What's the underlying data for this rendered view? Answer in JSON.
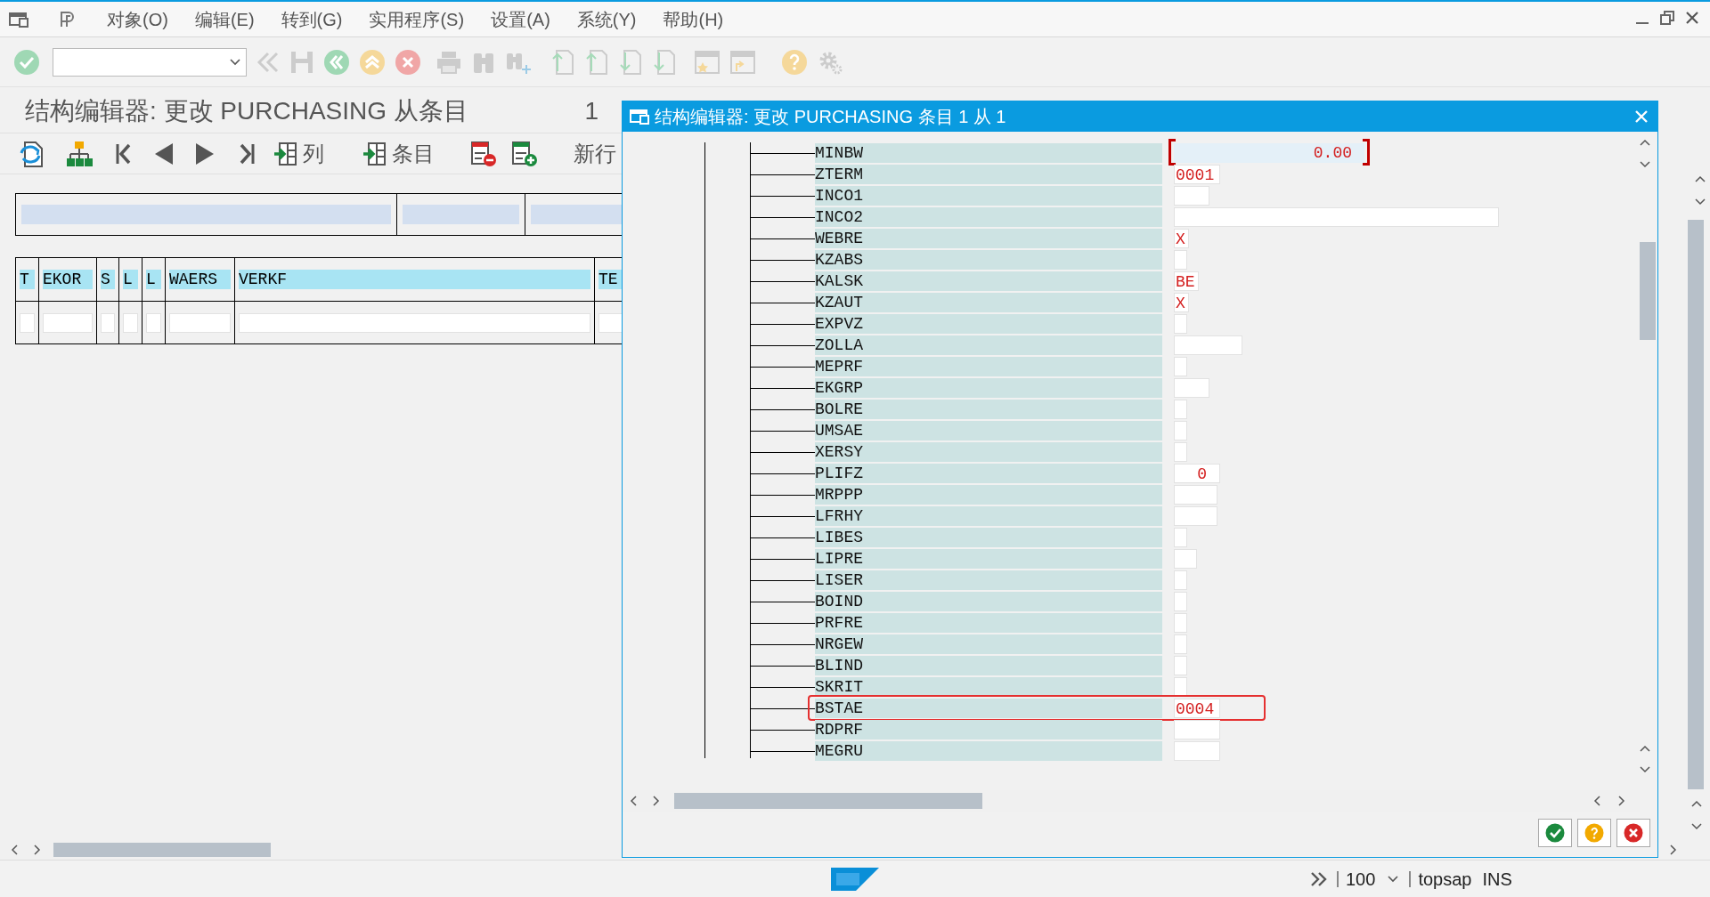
{
  "menu_bar": {
    "items": [
      "对象(O)",
      "编辑(E)",
      "转到(G)",
      "实用程序(S)",
      "设置(A)",
      "系统(Y)",
      "帮助(H)"
    ]
  },
  "screen": {
    "title": "结构编辑器: 更改 PURCHASING 从条目",
    "entry_count": "1"
  },
  "app_toolbar": {
    "columns_label": "列",
    "entries_label": "条目",
    "new_row_button": "新行"
  },
  "table": {
    "columns": [
      "T",
      "EKOR",
      "S",
      "L",
      "L",
      "WAERS",
      "VERKF",
      "TE"
    ]
  },
  "dialog": {
    "title": "结构编辑器: 更改 PURCHASING 条目 1 从 1",
    "rows": [
      {
        "name": "MINBW",
        "kind": "numeric",
        "value": "0.00",
        "focused": true,
        "highlighted": false
      },
      {
        "name": "ZTERM",
        "kind": "char",
        "value": "0001",
        "focused": false,
        "highlighted": false
      },
      {
        "name": "INCO1",
        "kind": "char",
        "focused": false,
        "highlighted": false
      },
      {
        "name": "INCO2",
        "kind": "char",
        "focused": false,
        "highlighted": false
      },
      {
        "name": "WEBRE",
        "kind": "char",
        "value": "X",
        "focused": false,
        "highlighted": false
      },
      {
        "name": "KZABS",
        "kind": "char",
        "focused": false,
        "highlighted": false
      },
      {
        "name": "KALSK",
        "kind": "char",
        "value": "BE",
        "focused": false,
        "highlighted": false
      },
      {
        "name": "KZAUT",
        "kind": "char",
        "value": "X",
        "focused": false,
        "highlighted": false
      },
      {
        "name": "EXPVZ",
        "kind": "char",
        "focused": false,
        "highlighted": false
      },
      {
        "name": "ZOLLA",
        "kind": "char",
        "focused": false,
        "highlighted": false
      },
      {
        "name": "MEPRF",
        "kind": "char",
        "focused": false,
        "highlighted": false
      },
      {
        "name": "EKGRP",
        "kind": "char",
        "focused": false,
        "highlighted": false
      },
      {
        "name": "BOLRE",
        "kind": "char",
        "focused": false,
        "highlighted": false
      },
      {
        "name": "UMSAE",
        "kind": "char",
        "focused": false,
        "highlighted": false
      },
      {
        "name": "XERSY",
        "kind": "char",
        "focused": false,
        "highlighted": false
      },
      {
        "name": "PLIFZ",
        "kind": "numeric",
        "value": "0",
        "focused": false,
        "highlighted": false
      },
      {
        "name": "MRPPP",
        "kind": "char",
        "focused": false,
        "highlighted": false
      },
      {
        "name": "LFRHY",
        "kind": "char",
        "focused": false,
        "highlighted": false
      },
      {
        "name": "LIBES",
        "kind": "char",
        "focused": false,
        "highlighted": false
      },
      {
        "name": "LIPRE",
        "kind": "char",
        "focused": false,
        "highlighted": false
      },
      {
        "name": "LISER",
        "kind": "char",
        "focused": false,
        "highlighted": false
      },
      {
        "name": "BOIND",
        "kind": "char",
        "focused": false,
        "highlighted": false
      },
      {
        "name": "PRFRE",
        "kind": "char",
        "focused": false,
        "highlighted": false
      },
      {
        "name": "NRGEW",
        "kind": "char",
        "focused": false,
        "highlighted": false
      },
      {
        "name": "BLIND",
        "kind": "char",
        "focused": false,
        "highlighted": false
      },
      {
        "name": "SKRIT",
        "kind": "char",
        "focused": false,
        "highlighted": false
      },
      {
        "name": "BSTAE",
        "kind": "char",
        "value": "0004",
        "focused": false,
        "highlighted": true
      },
      {
        "name": "RDPRF",
        "kind": "char",
        "focused": false,
        "highlighted": false
      },
      {
        "name": "MEGRU",
        "kind": "char",
        "focused": false,
        "highlighted": false
      }
    ]
  },
  "status_bar": {
    "zoom": "100",
    "user": "topsap",
    "mode": "INS"
  }
}
